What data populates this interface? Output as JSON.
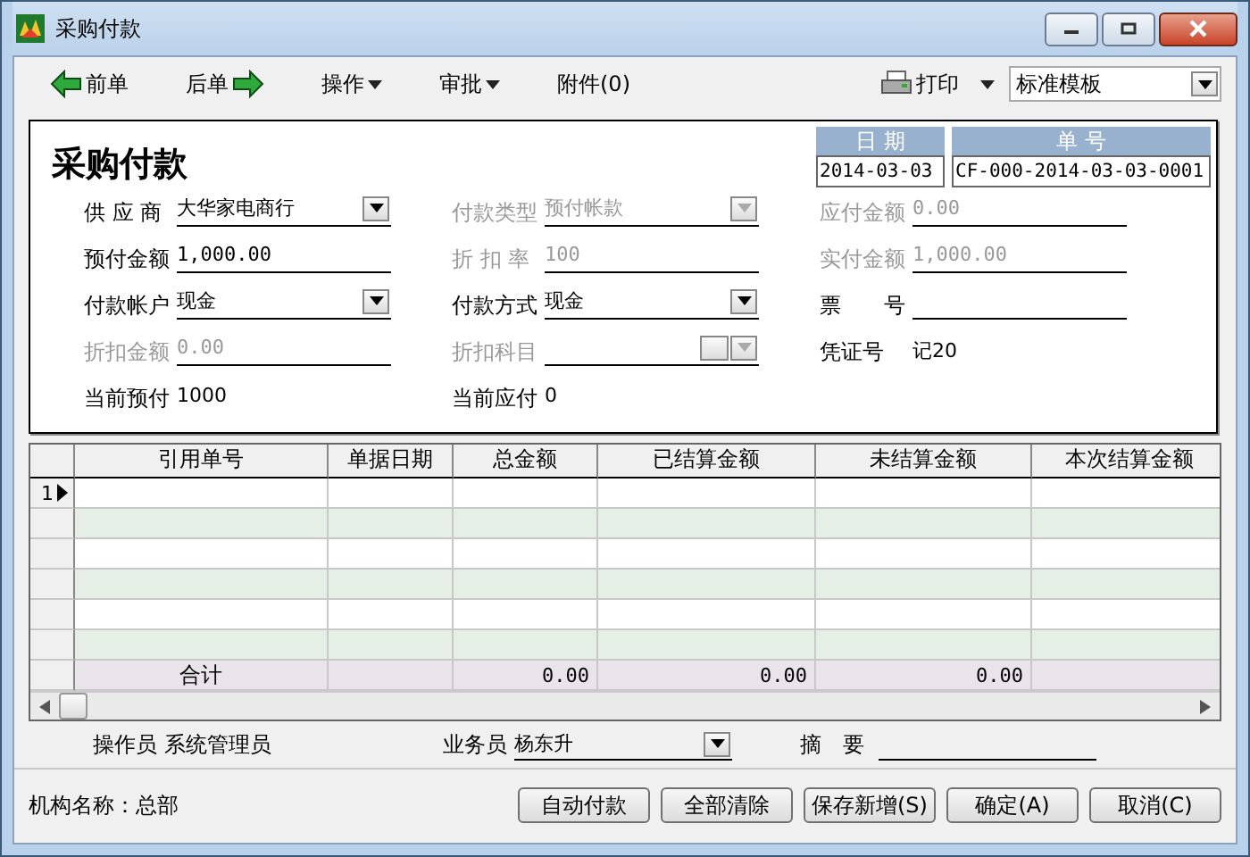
{
  "window": {
    "title": "采购付款"
  },
  "toolbar": [
    {
      "label": "前单",
      "kind": "prev"
    },
    {
      "label": "后单",
      "kind": "next"
    },
    {
      "label": "操作",
      "kind": "menu"
    },
    {
      "label": "审批",
      "kind": "menu"
    },
    {
      "label": "附件(0)",
      "kind": "plain"
    },
    {
      "label": "打印",
      "kind": "print"
    }
  ],
  "template": {
    "value": "标准模板"
  },
  "form": {
    "title": "采购付款",
    "date": {
      "label": "日 期",
      "value": "2014-03-03"
    },
    "number": {
      "label": "单 号",
      "value": "CF-000-2014-03-03-0001"
    },
    "columns": [
      [
        {
          "label": "供 应 商",
          "value": "大华家电商行",
          "kind": "dropdown",
          "disabled": false
        },
        {
          "label": "预付金额",
          "value": "1,000.00",
          "kind": "field",
          "disabled": false
        },
        {
          "label": "付款帐户",
          "value": "现金",
          "kind": "dropdown",
          "disabled": false
        },
        {
          "label": "折扣金额",
          "value": "0.00",
          "kind": "field",
          "disabled": true
        },
        {
          "label": "当前预付",
          "value": "1000",
          "kind": "plain",
          "disabled": false
        }
      ],
      [
        {
          "label": "付款类型",
          "value": "预付帐款",
          "kind": "dropdown",
          "disabled": true
        },
        {
          "label": "折 扣 率",
          "value": "100",
          "kind": "field",
          "disabled": true
        },
        {
          "label": "付款方式",
          "value": "现金",
          "kind": "dropdown",
          "disabled": false
        },
        {
          "label": "折扣科目",
          "kind": "picker",
          "disabled": true
        },
        {
          "label": "当前应付",
          "value": "0",
          "kind": "plain",
          "disabled": false
        }
      ],
      [
        {
          "label": "应付金额",
          "value": "0.00",
          "kind": "field",
          "disabled": true
        },
        {
          "label": "实付金额",
          "value": "1,000.00",
          "kind": "field",
          "disabled": true
        },
        {
          "label": "票　　号",
          "kind": "field",
          "disabled": false
        },
        {
          "label": "凭证号",
          "value": "记20",
          "kind": "plain",
          "disabled": false
        }
      ]
    ]
  },
  "table": {
    "columns": [
      "引用单号",
      "单据日期",
      "总金额",
      "已结算金额",
      "未结算金额",
      "本次结算金额"
    ],
    "rows": [
      {
        "number": "1",
        "selected": true
      },
      {
        "selected": false
      },
      {
        "selected": false
      },
      {
        "selected": false
      },
      {
        "selected": false
      },
      {
        "selected": false
      }
    ],
    "totals": {
      "label": "合计",
      "total": "0.00",
      "settled": "0.00",
      "unsettled": "0.00"
    }
  },
  "footer": {
    "operator": {
      "label": "操作员",
      "value": "系统管理员"
    },
    "salesman": {
      "label": "业务员",
      "value": "杨东升"
    },
    "summary": {
      "label": "摘　要"
    }
  },
  "status": "机构名称：总部",
  "buttons": [
    "自动付款",
    "全部清除",
    "保存新增(S)",
    "确定(A)",
    "取消(C)"
  ]
}
